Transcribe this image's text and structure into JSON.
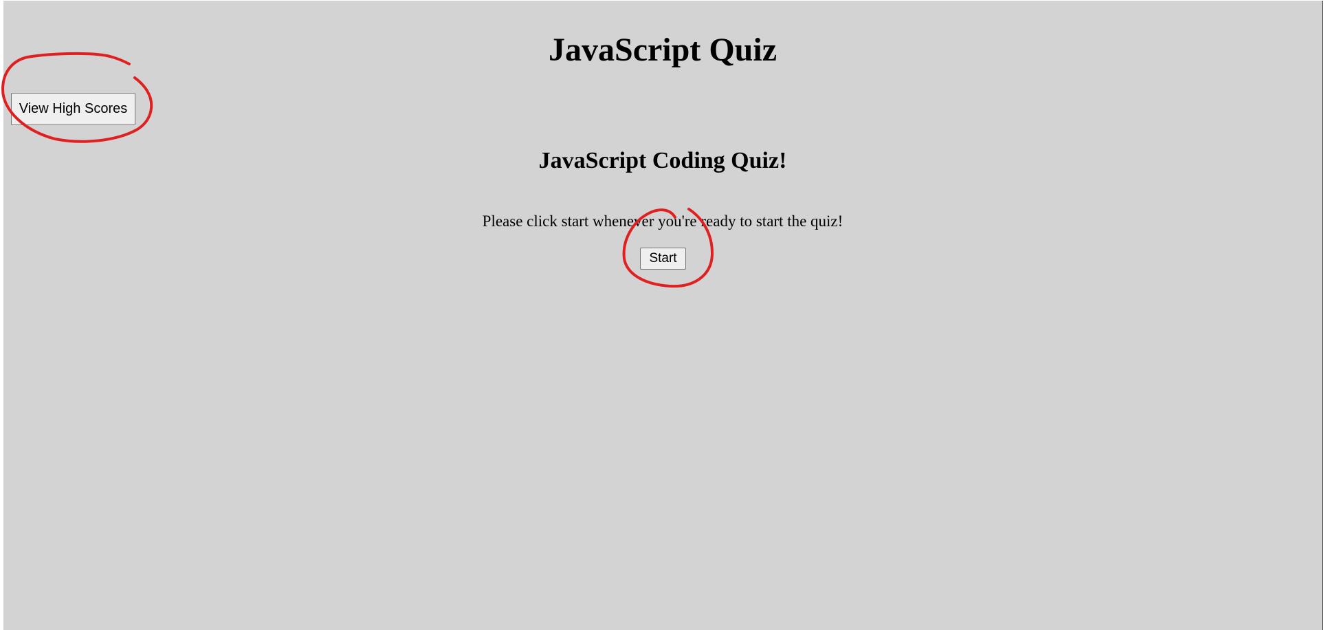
{
  "header": {
    "title": "JavaScript Quiz",
    "high_scores_label": "View High Scores"
  },
  "quiz": {
    "heading": "JavaScript Coding Quiz!",
    "instructions": "Please click start whenever you're ready to start the quiz!",
    "start_label": "Start"
  },
  "annotation_color": "#e02020"
}
